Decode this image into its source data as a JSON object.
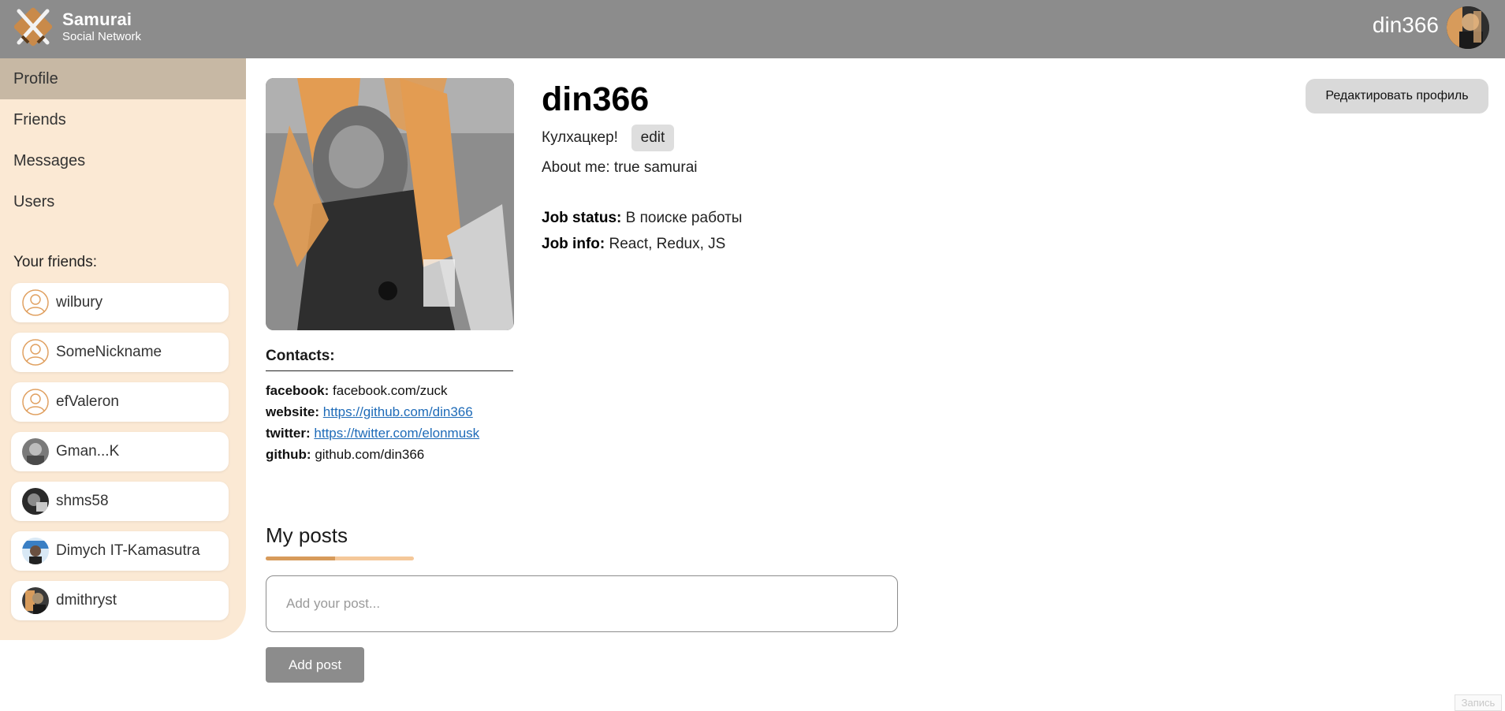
{
  "colors": {
    "header_bg": "#8c8c8c",
    "sidebar_bg": "#fbe9d4",
    "nav_active_bg": "#c7b8a4",
    "accent": "#d79b5b",
    "link": "#1e6bb8"
  },
  "header": {
    "brand_name": "Samurai",
    "brand_sub": "Social Network",
    "logo_icon": "crossed-swords-icon",
    "username": "din366"
  },
  "sidebar": {
    "nav": [
      {
        "label": "Profile",
        "active": true
      },
      {
        "label": "Friends",
        "active": false
      },
      {
        "label": "Messages",
        "active": false
      },
      {
        "label": "Users",
        "active": false
      }
    ],
    "friends_title": "Your friends:",
    "friends": [
      {
        "name": "wilbury",
        "avatar": "default-user-icon"
      },
      {
        "name": "SomeNickname",
        "avatar": "default-user-icon"
      },
      {
        "name": "efValeron",
        "avatar": "default-user-icon"
      },
      {
        "name": "Gman...K",
        "avatar": "photo"
      },
      {
        "name": "shms58",
        "avatar": "photo"
      },
      {
        "name": "Dimych IT-Kamasutra",
        "avatar": "photo"
      },
      {
        "name": "dmithryst",
        "avatar": "photo"
      }
    ]
  },
  "profile": {
    "name": "din366",
    "status": "Кулхацкер!",
    "status_edit_label": "edit",
    "about": "About me: true samurai",
    "job_status_label": "Job status:",
    "job_status_value": "В поиске работы",
    "job_info_label": "Job info:",
    "job_info_value": "React, Redux, JS",
    "edit_profile_label": "Редактировать профиль"
  },
  "contacts": {
    "title": "Contacts:",
    "items": [
      {
        "label": "facebook:",
        "value": "facebook.com/zuck",
        "link": false
      },
      {
        "label": "website:",
        "value": "https://github.com/din366",
        "link": true
      },
      {
        "label": "twitter:",
        "value": "https://twitter.com/elonmusk",
        "link": true
      },
      {
        "label": "github:",
        "value": "github.com/din366",
        "link": false
      }
    ]
  },
  "posts": {
    "title": "My posts",
    "bar_fill_fraction": 0.47,
    "input_value": "",
    "input_placeholder": "Add your post...",
    "add_button_label": "Add post"
  },
  "corner_tag": "Запись"
}
